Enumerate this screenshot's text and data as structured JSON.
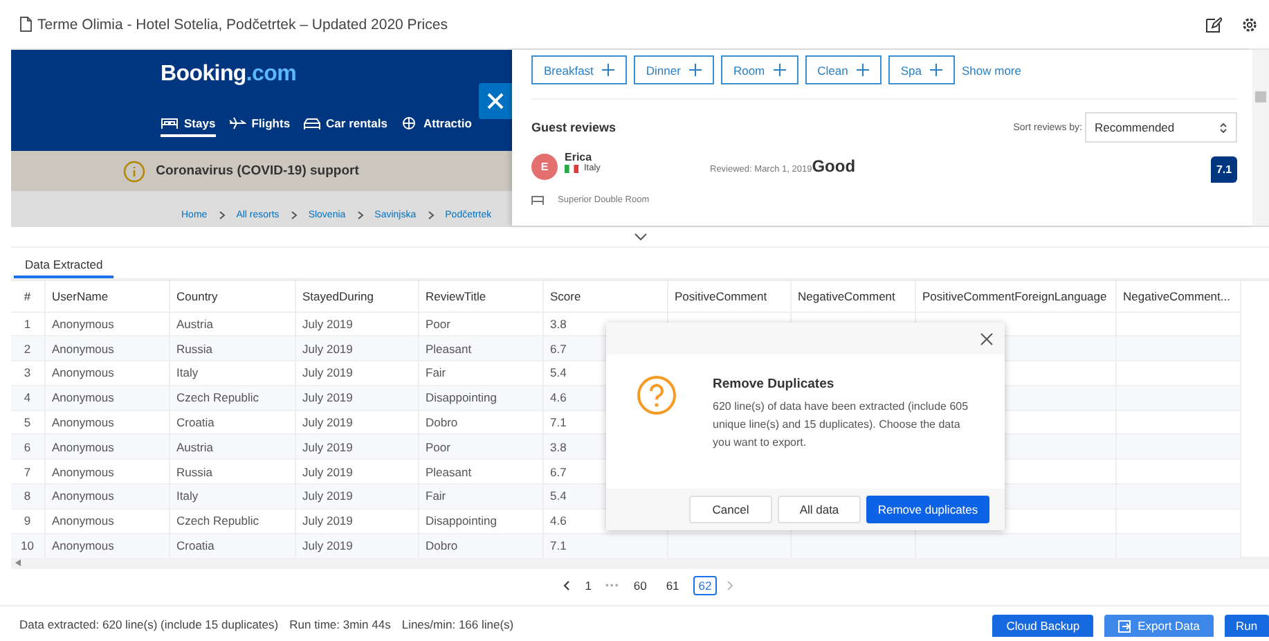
{
  "window": {
    "title": "Terme Olimia - Hotel Sotelia, Podčetrtek – Updated 2020 Prices"
  },
  "browser": {
    "logo": "Booking",
    "logo_suffix": ".com",
    "nav": [
      {
        "label": "Stays",
        "selected": true
      },
      {
        "label": "Flights",
        "selected": false
      },
      {
        "label": "Car rentals",
        "selected": false
      },
      {
        "label": "Attractio",
        "selected": false
      }
    ],
    "notice": "Coronavirus (COVID-19) support",
    "breadcrumb": [
      "Home",
      "All resorts",
      "Slovenia",
      "Savinjska",
      "Podčetrtek"
    ],
    "filters": [
      "Breakfast",
      "Dinner",
      "Room",
      "Clean",
      "Spa"
    ],
    "show_more": "Show more",
    "reviews_heading": "Guest reviews",
    "sort_label": "Sort reviews by:",
    "sort_value": "Recommended",
    "review": {
      "initial": "E",
      "name": "Erica",
      "country": "Italy",
      "date": "Reviewed: March 1, 2019",
      "title": "Good",
      "score": "7.1",
      "room": "Superior Double Room"
    }
  },
  "tabs": [
    {
      "label": "Data Extracted",
      "selected": true
    }
  ],
  "table": {
    "columns": [
      "#",
      "UserName",
      "Country",
      "StayedDuring",
      "ReviewTitle",
      "Score",
      "PositiveComment",
      "NegativeComment",
      "PositiveCommentForeignLanguage",
      "NegativeComment..."
    ],
    "rows": [
      [
        "1",
        "Anonymous",
        "Austria",
        "July 2019",
        "Poor",
        "3.8"
      ],
      [
        "2",
        "Anonymous",
        "Russia",
        "July 2019",
        "Pleasant",
        "6.7"
      ],
      [
        "3",
        "Anonymous",
        "Italy",
        "July 2019",
        "Fair",
        "5.4"
      ],
      [
        "4",
        "Anonymous",
        "Czech Republic",
        "July 2019",
        "Disappointing",
        "4.6"
      ],
      [
        "5",
        "Anonymous",
        "Croatia",
        "July 2019",
        "Dobro",
        "7.1"
      ],
      [
        "6",
        "Anonymous",
        "Austria",
        "July 2019",
        "Poor",
        "3.8"
      ],
      [
        "7",
        "Anonymous",
        "Russia",
        "July 2019",
        "Pleasant",
        "6.7"
      ],
      [
        "8",
        "Anonymous",
        "Italy",
        "July 2019",
        "Fair",
        "5.4"
      ],
      [
        "9",
        "Anonymous",
        "Czech Republic",
        "July 2019",
        "Disappointing",
        "4.6"
      ],
      [
        "10",
        "Anonymous",
        "Croatia",
        "July 2019",
        "Dobro",
        "7.1"
      ]
    ]
  },
  "dialog": {
    "title": "Remove Duplicates",
    "message": "620 line(s) of data have been extracted (include 605 unique line(s) and 15 duplicates). Choose the data you want to export.",
    "buttons": [
      {
        "label": "Cancel",
        "kind": "plain"
      },
      {
        "label": "All data",
        "kind": "plain"
      },
      {
        "label": "Remove duplicates",
        "kind": "primary"
      }
    ]
  },
  "pagination": {
    "first": "1",
    "ellipsis": "•••",
    "pages": [
      {
        "label": "60",
        "selected": false
      },
      {
        "label": "61",
        "selected": false
      },
      {
        "label": "62",
        "selected": true
      }
    ]
  },
  "status": {
    "extracted": "Data extracted: 620 line(s) (include 15 duplicates)",
    "run_time": "Run time: 3min 44s",
    "rate": "Lines/min: 166 line(s)"
  },
  "actions": [
    {
      "label": "Cloud Backup",
      "kind": "plain"
    },
    {
      "label": "Export Data",
      "kind": "export"
    },
    {
      "label": "Run",
      "kind": "plain"
    }
  ]
}
